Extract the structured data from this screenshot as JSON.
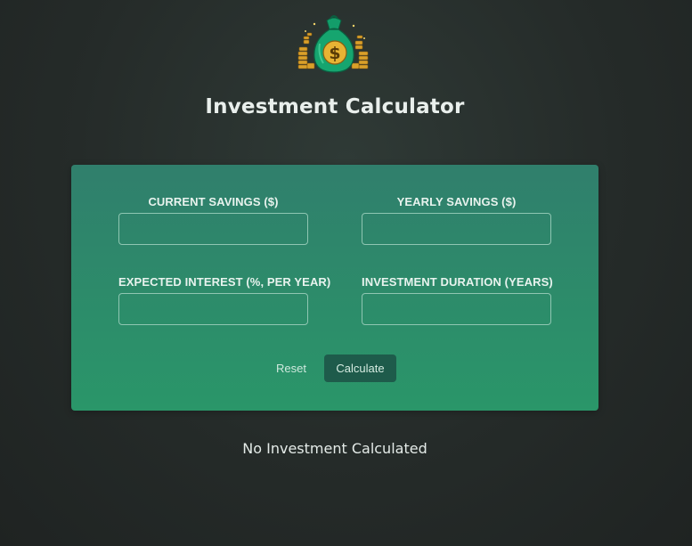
{
  "app": {
    "title": "Investment Calculator"
  },
  "form": {
    "fields": [
      {
        "label": "CURRENT SAVINGS ($)",
        "value": "",
        "placeholder": ""
      },
      {
        "label": "YEARLY SAVINGS ($)",
        "value": "",
        "placeholder": ""
      },
      {
        "label": "EXPECTED INTEREST (%, PER YEAR)",
        "value": "",
        "placeholder": ""
      },
      {
        "label": "INVESTMENT DURATION (YEARS)",
        "value": "",
        "placeholder": ""
      }
    ],
    "reset_label": "Reset",
    "calculate_label": "Calculate"
  },
  "result": {
    "message": "No Investment Calculated"
  },
  "colors": {
    "background": "#252b29",
    "card_top": "#307f6c",
    "card_bottom": "#2a9669",
    "calculate_button": "#1e5b4b",
    "logo_bag": "#1aa36f",
    "logo_coin": "#e0a92a"
  },
  "logo": {
    "icon": "money-bag-icon"
  }
}
